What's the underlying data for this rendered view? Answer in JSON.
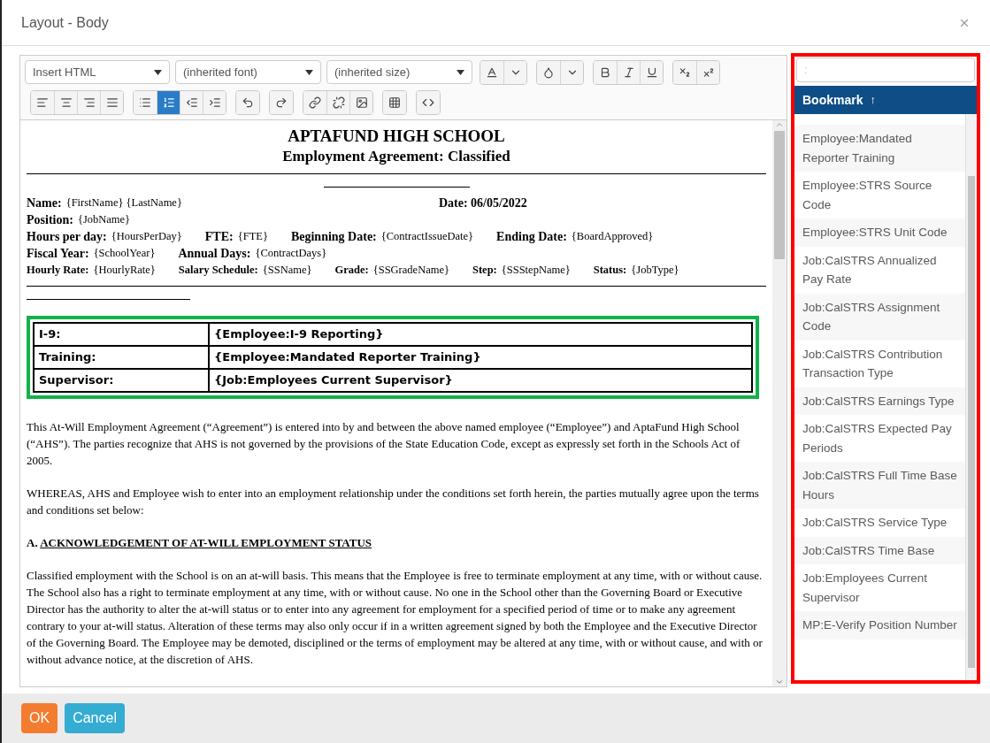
{
  "window": {
    "title": "Layout - Body"
  },
  "toolbar": {
    "dropdowns": [
      {
        "value": "Insert HTML"
      },
      {
        "value": "(inherited font)"
      },
      {
        "value": "(inherited size)"
      }
    ],
    "row1_groups": [
      [
        {
          "selected": false
        },
        {
          "selected": false
        }
      ],
      [
        {
          "selected": false
        },
        {
          "selected": false
        }
      ],
      [
        {
          "selected": false
        },
        {
          "selected": false
        },
        {
          "selected": false
        }
      ],
      [
        {
          "selected": false
        },
        {
          "selected": false
        }
      ]
    ],
    "row2_groups": [
      [
        {
          "selected": false
        },
        {
          "selected": false
        },
        {
          "selected": false
        },
        {
          "selected": false
        }
      ],
      [
        {
          "selected": false
        },
        {
          "selected": true
        },
        {
          "selected": false
        },
        {
          "selected": false
        }
      ],
      [
        {
          "selected": false
        }
      ],
      [
        {
          "selected": false
        }
      ],
      [
        {
          "selected": false
        },
        {
          "selected": false
        },
        {
          "selected": false
        }
      ],
      [
        {
          "selected": false
        }
      ],
      [
        {
          "selected": false
        }
      ]
    ]
  },
  "document": {
    "school": "APTAFUND HIGH SCHOOL",
    "subtitle": "Employment Agreement: Classified",
    "info_lines": [
      {
        "kind": "split",
        "items": [
          {
            "label": "Name:",
            "value": "{FirstName} {LastName}"
          },
          {
            "label": "Date: 06/05/2022",
            "value": ""
          }
        ]
      },
      {
        "kind": "large",
        "items": [
          {
            "label": "Position:",
            "value": "{JobName}"
          }
        ]
      },
      {
        "kind": "large",
        "items": [
          {
            "label": "Hours per day:",
            "value": "{HoursPerDay}"
          },
          {
            "label": "FTE:",
            "value": "{FTE}"
          },
          {
            "label": "Beginning Date:",
            "value": "{ContractIssueDate}"
          },
          {
            "label": "Ending Date:",
            "value": "{BoardApproved}"
          }
        ]
      },
      {
        "kind": "large",
        "items": [
          {
            "label": "Fiscal Year:",
            "value": "{SchoolYear}"
          },
          {
            "label": "Annual Days:",
            "value": "{ContractDays}"
          }
        ]
      },
      {
        "kind": "small",
        "items": [
          {
            "label": "Hourly Rate:",
            "value": "{HourlyRate}"
          },
          {
            "label": "Salary Schedule:",
            "value": "{SSName}"
          },
          {
            "label": "Grade:",
            "value": "{SSGradeName}"
          },
          {
            "label": "Step:",
            "value": "{SSStepName}"
          },
          {
            "label": "Status:",
            "value": "{JobType}"
          }
        ]
      }
    ],
    "mapping_rows": [
      {
        "label": "I-9:",
        "value": "{Employee:I-9 Reporting}"
      },
      {
        "label": "Training:",
        "value": "{Employee:Mandated Reporter Training}"
      },
      {
        "label": "Supervisor:",
        "value": "{Job:Employees Current Supervisor}"
      }
    ],
    "paragraphs": [
      {
        "kind": "text",
        "text": "This At-Will Employment Agreement (“Agreement”) is entered into by and between the above named employee (“Employee”) and AptaFund High School (“AHS”).  The parties recognize that AHS is not governed by the provisions of the State Education Code, except as expressly set forth in the Schools Act of 2005."
      },
      {
        "kind": "text",
        "text": "WHEREAS, AHS and Employee wish to enter into an employment relationship under the conditions set forth herein, the parties mutually agree upon the terms and conditions set below:"
      },
      {
        "kind": "heading",
        "number": "A.",
        "text": "ACKNOWLEDGEMENT OF AT-WILL EMPLOYMENT STATUS"
      },
      {
        "kind": "text",
        "text": "Classified employment with the School is on an at-will basis.  This means that the Employee is free to terminate employment at any time, with or without cause.  The School also has a right to terminate employment at any time, with or without cause.  No one in the School other than the Governing Board or Executive Director has the authority to alter the at-will status or to enter into any agreement for employment for a specified period of time or to make any agreement contrary to your at-will status.  Alteration of these terms may also only occur if in a written agreement signed by both the Employee and the Executive Director of the Governing Board.  The Employee may be demoted, disciplined or the terms of employment may be altered at any time, with or without cause, and with or without advance notice, at the discretion of AHS."
      }
    ]
  },
  "bookmarks": {
    "search": {
      "placeholder": ":"
    },
    "column": "Bookmark",
    "sort": "↑",
    "items": [
      "Employee:Mandated Reporter Training",
      "Employee:STRS Source Code",
      "Employee:STRS Unit Code",
      "Job:CalSTRS Annualized Pay Rate",
      "Job:CalSTRS Assignment Code",
      "Job:CalSTRS Contribution Transaction Type",
      "Job:CalSTRS Earnings Type",
      "Job:CalSTRS Expected Pay Periods",
      "Job:CalSTRS Full Time Base Hours",
      "Job:CalSTRS Service Type",
      "Job:CalSTRS Time Base",
      "Job:Employees Current Supervisor",
      "MP:E-Verify Position Number"
    ]
  },
  "buttons": [
    {
      "kind": "primary",
      "label": "OK"
    },
    {
      "kind": "secondary",
      "label": "Cancel"
    }
  ]
}
